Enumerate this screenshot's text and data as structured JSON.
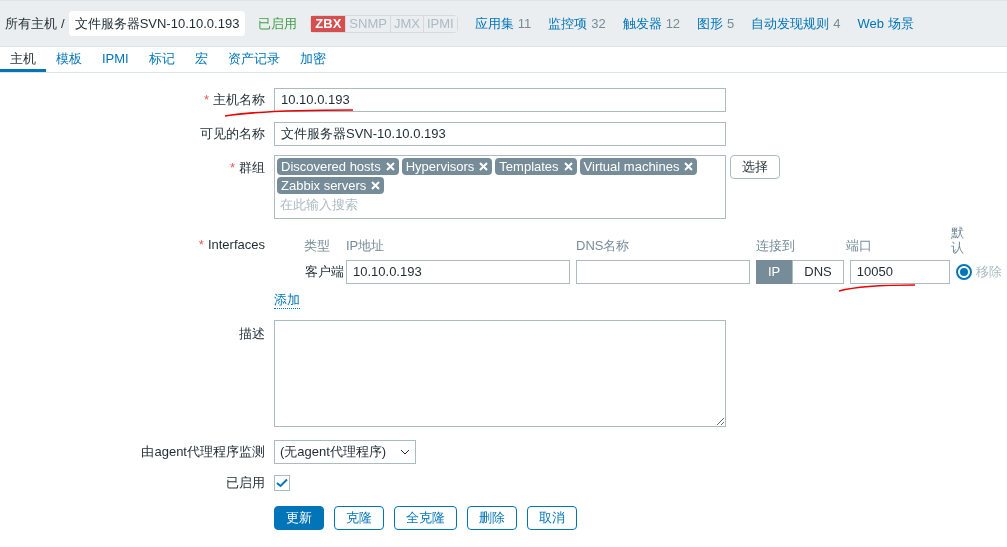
{
  "breadcrumb": {
    "root": "所有主机",
    "separator": "/",
    "current": "文件服务器SVN-10.10.0.193"
  },
  "status": "已启用",
  "badges": [
    {
      "label": "ZBX",
      "selected": true
    },
    {
      "label": "SNMP",
      "selected": false
    },
    {
      "label": "JMX",
      "selected": false
    },
    {
      "label": "IPMI",
      "selected": false
    }
  ],
  "links": [
    {
      "label": "应用集",
      "count": "11"
    },
    {
      "label": "监控项",
      "count": "32"
    },
    {
      "label": "触发器",
      "count": "12"
    },
    {
      "label": "图形",
      "count": "5"
    },
    {
      "label": "自动发现规则",
      "count": "4"
    },
    {
      "label": "Web 场景"
    }
  ],
  "tabs": [
    {
      "label": "主机",
      "selected": true
    },
    {
      "label": "模板",
      "selected": false
    },
    {
      "label": "IPMI",
      "selected": false
    },
    {
      "label": "标记",
      "selected": false
    },
    {
      "label": "宏",
      "selected": false
    },
    {
      "label": "资产记录",
      "selected": false
    },
    {
      "label": "加密",
      "selected": false
    }
  ],
  "host_name": {
    "label": "主机名称",
    "required_mark": "*",
    "value": "10.10.0.193"
  },
  "visible_name": {
    "label": "可见的名称",
    "value": "文件服务器SVN-10.10.0.193"
  },
  "groups": {
    "label": "群组",
    "required_mark": "*",
    "tags": [
      "Discovered hosts",
      "Hypervisors",
      "Templates",
      "Virtual machines",
      "Zabbix servers"
    ],
    "placeholder": "在此输入搜索",
    "select_button": "选择"
  },
  "interfaces": {
    "label": "Interfaces",
    "required_mark": "*",
    "columns": [
      "类型",
      "IP地址",
      "DNS名称",
      "连接到",
      "端口",
      "默认"
    ],
    "rows": [
      {
        "type": "客户端",
        "ip": "10.10.0.193",
        "connect": [
          {
            "label": "IP",
            "selected": true
          },
          {
            "label": "DNS",
            "selected": false
          }
        ],
        "port": "10050",
        "default": true,
        "remove": "移除"
      }
    ],
    "add": "添加"
  },
  "description": {
    "label": "描述"
  },
  "proxy": {
    "label": "由agent代理程序监测",
    "value": "(无agent代理程序)"
  },
  "enabled": {
    "label": "已启用",
    "checked": true
  },
  "buttons": [
    {
      "label": "更新",
      "primary": true
    },
    {
      "label": "克隆",
      "primary": false
    },
    {
      "label": "全克隆",
      "primary": false
    },
    {
      "label": "删除",
      "primary": false
    },
    {
      "label": "取消",
      "primary": false
    }
  ]
}
